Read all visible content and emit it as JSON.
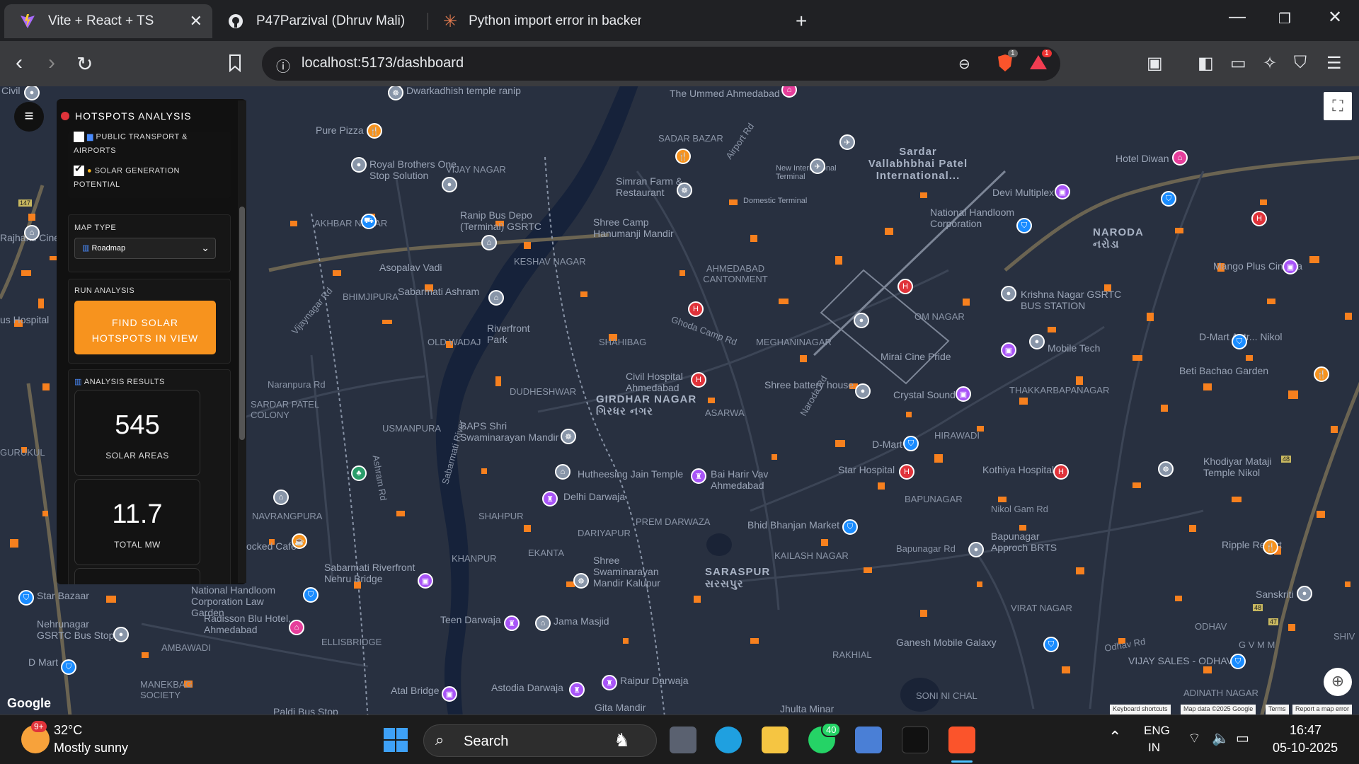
{
  "browser": {
    "tabs": [
      {
        "title": "Vite + React + TS",
        "icon": "vite-icon"
      },
      {
        "title": "P47Parzival (Dhruv Mali)",
        "icon": "github-icon"
      },
      {
        "title": "Python import error in backend - Cla",
        "icon": "claude-icon"
      }
    ],
    "url": "localhost:5173/dashboard",
    "brave_badge": "1",
    "rewards_badge": "1"
  },
  "panel": {
    "title": "HOTSPOTS ANALYSIS",
    "layers": [
      {
        "label": "PUBLIC TRANSPORT &",
        "label2": "AIRPORTS",
        "checked": false
      },
      {
        "label": "SOLAR GENERATION",
        "label2": "POTENTIAL",
        "checked": true
      }
    ],
    "map_type_label": "MAP TYPE",
    "map_type_value": "Roadmap",
    "run_label": "RUN ANALYSIS",
    "button_line1": "FIND SOLAR",
    "button_line2": "HOTSPOTS IN VIEW",
    "results_label": "ANALYSIS RESULTS",
    "stats": [
      {
        "value": "545",
        "label": "SOLAR AREAS"
      },
      {
        "value": "11.7",
        "label": "TOTAL MW"
      }
    ]
  },
  "map": {
    "areas": [
      {
        "text": "NARODA",
        "sub": "નરોડા"
      },
      {
        "text": "SARASPUR",
        "sub": "સરસપુર"
      },
      {
        "text": "GIRDHAR NAGAR",
        "sub": "ગિરધર નગર"
      },
      {
        "text": "Sardar Vallabhbhai Patel International..."
      }
    ],
    "places": [
      "Dwarkadhish temple ranip",
      "Pure Pizza",
      "Royal Brothers One Stop Solution",
      "Simran Farm & Restaurant",
      "Shree Camp Hanumanji Mandir",
      "Ranip Bus Depo (Terminal) GSRTC",
      "Sabarmati Ashram",
      "Riverfront Park",
      "Civil Hospital Ahmedabad",
      "Shree battery house",
      "Crystal Sound",
      "Mirai Cine Pride",
      "D-Mart",
      "Star Hospital",
      "Hutheesing Jain Temple",
      "Bai Harir Vav Ahmedabad",
      "Delhi Darwaja",
      "BAPS Shri Swaminarayan Mandir",
      "Bhid Bhanjan Market",
      "Shree Swaminarayan Mandir Kalupur",
      "Jama Masjid",
      "Teen Darwaja",
      "Kothiya Hospital",
      "Devi Multiplex",
      "National Handloom Corporation",
      "Krishna Nagar GSRTC BUS STATION",
      "Mobile Tech",
      "Bapunagar Approch BRTS",
      "Ganesh Mobile Galaxy",
      "Raipur Darwaja",
      "Astodia Darwaja",
      "Atal Bridge",
      "National Handloom Corporation Law Garden",
      "Radisson Blu Hotel, Ahmedabad",
      "Nehrunagar GSRTC Bus Stop",
      "Star Bazaar",
      "D Mart",
      "Mango Plus Cinema",
      "Hotel Diwan",
      "Beti Bachao Garden",
      "Khodiyar Mataji Temple Nikol",
      "Sanskriti",
      "Ripple Resort",
      "Sabarmati Riverfront Nehru Bridge",
      "Asopalav Vadi",
      "The Ummed Ahmedabad",
      "New International Terminal",
      "Domestic Terminal",
      "Jhulta Minar",
      "Gita Mandir",
      "Paldi Bus Stop",
      "ocked Cafe",
      "us Hospital",
      "D-Mart Antr... Nikol",
      "VIJAY SALES - ODHAV",
      "Civil",
      "Rajhans Cine"
    ],
    "neighbourhoods": [
      "VIJAY NAGAR",
      "AKHBAR NAGAR",
      "KESHAV NAGAR",
      "BHIMJIPURA",
      "OLD WADAJ",
      "SHAHIBAG",
      "DUDHESHWAR",
      "ASARWA",
      "MEGHANINAGAR",
      "OM NAGAR",
      "HIRAWADI",
      "THAKKARBAPANAGAR",
      "BAPUNAGAR",
      "KAILASH NAGAR",
      "PREM DARWAZA",
      "DARIYAPUR",
      "SHAHPUR",
      "KHANPUR",
      "EKANTA",
      "NAVRANGPURA",
      "USMANPURA",
      "SARDAR PATEL COLONY",
      "GURUKUL",
      "AMBAWADI",
      "ELLISBRIDGE",
      "MANEKBAG SOCIETY",
      "RAKHIAL",
      "VIRAT NAGAR",
      "SONI NI CHAL",
      "ODHAV",
      "G V M M",
      "ADINATH NAGAR",
      "AHMEDABAD CANTONMENT",
      "SADAR BAZAR",
      "SHIV"
    ],
    "roads": [
      "Airport Rd",
      "Nikol Gam Rd",
      "Odhav Rd",
      "Naroda Rd",
      "Ghoda Camp Rd",
      "Bapunagar Rd",
      "Vijaynagar Rd",
      "Naranpura Rd",
      "Ashram Rd",
      "Sabarmati River"
    ],
    "highway_shields": [
      "147",
      "48",
      "48",
      "47"
    ],
    "google": "Google",
    "attribution": [
      "Keyboard shortcuts",
      "Map data ©2025 Google",
      "Terms",
      "Report a map error"
    ]
  },
  "taskbar": {
    "weather_badge": "9+",
    "temperature": "32°C",
    "weather": "Mostly sunny",
    "search": "Search",
    "whatsapp_badge": "40",
    "lang1": "ENG",
    "lang2": "IN",
    "time": "16:47",
    "date": "05-10-2025"
  }
}
